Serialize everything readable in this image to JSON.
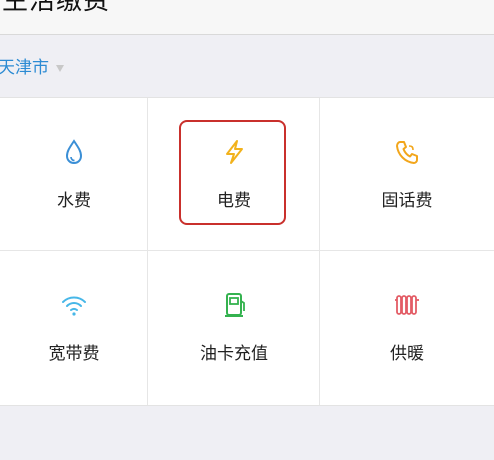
{
  "header": {
    "title": "生活缴费",
    "back_icon": "back-arrow-icon",
    "more_icon": "more-dots-icon",
    "more_label": "···"
  },
  "city_selector": {
    "city": "天津市",
    "icon": "caret-down-icon"
  },
  "services": [
    {
      "label": "水费",
      "icon": "water-drop-icon",
      "color": "#3b8fd6"
    },
    {
      "label": "电费",
      "icon": "lightning-icon",
      "color": "#f2b21c"
    },
    {
      "label": "固话费",
      "icon": "phone-icon",
      "color": "#f2a61c"
    },
    {
      "label": "宽带费",
      "icon": "wifi-icon",
      "color": "#47b7e8"
    },
    {
      "label": "油卡充值",
      "icon": "gas-pump-icon",
      "color": "#34b24f"
    },
    {
      "label": "供暖",
      "icon": "radiator-icon",
      "color": "#e35d66"
    }
  ],
  "selection": {
    "highlighted_service": "电费",
    "highlight_color": "#c9302c"
  }
}
